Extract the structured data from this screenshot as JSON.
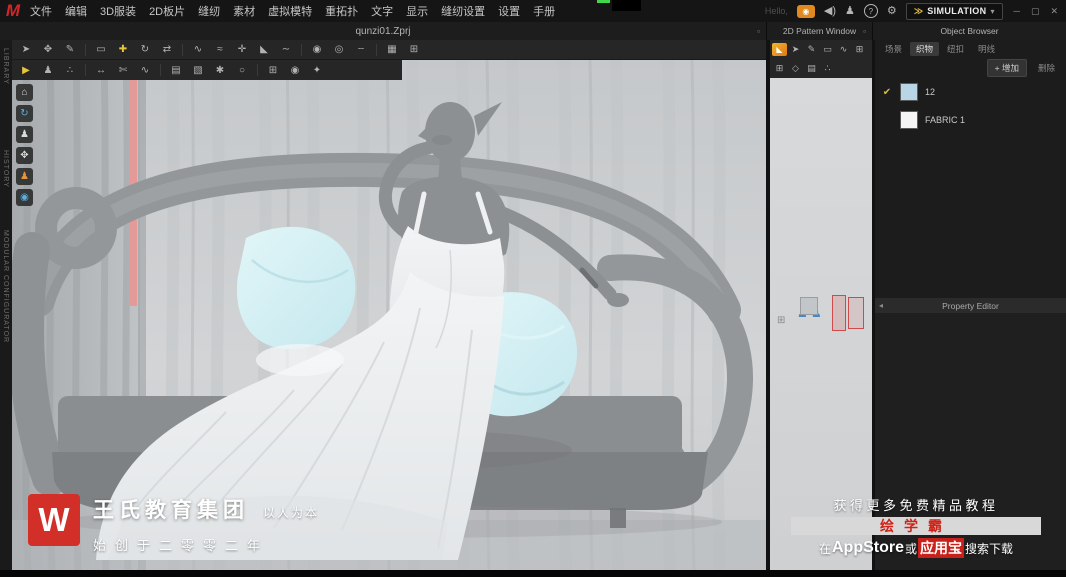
{
  "app": {
    "logo_letter": "M",
    "greeting": "Hello,",
    "simulation": {
      "chevrons": "≫",
      "label": "SIMULATION",
      "caret": "▾"
    },
    "window_controls": {
      "minimize": "─",
      "restore": "▢",
      "close": "✕"
    }
  },
  "menus": [
    "文件",
    "编辑",
    "3D服装",
    "2D板片",
    "缝纫",
    "素材",
    "虚拟模特",
    "重拓扑",
    "文字",
    "显示",
    "缝纫设置",
    "设置",
    "手册"
  ],
  "titles": {
    "project": "qunzi01.Zprj",
    "pattern_window": "2D Pattern Window",
    "object_browser": "Object Browser",
    "property_editor": "Property Editor"
  },
  "icons": {
    "camera": "◉",
    "speaker": "◀)",
    "user": "♟",
    "help": "?",
    "settings": "⚙",
    "panel_box": "▫",
    "left_arrow": "◂",
    "orange_tool": "◣"
  },
  "side_tabs": [
    "LIBRARY",
    "HISTORY",
    "MODULAR CONFIGURATOR"
  ],
  "toolbar3d_row1": [
    {
      "name": "select-tool",
      "glyph": "➤"
    },
    {
      "name": "transform-tool",
      "glyph": "✥"
    },
    {
      "name": "pen-tool",
      "glyph": "✎"
    },
    {
      "name": "rectangle-tool",
      "glyph": "▭"
    },
    {
      "name": "add-point-tool",
      "glyph": "✚"
    },
    {
      "name": "rotate-tool",
      "glyph": "↻"
    },
    {
      "name": "flip-tool",
      "glyph": "⇄"
    },
    {
      "name": "segment-sewing-tool",
      "glyph": "∿"
    },
    {
      "name": "free-sewing-tool",
      "glyph": "≈"
    },
    {
      "name": "pin-tool",
      "glyph": "✛"
    },
    {
      "name": "fold-arrangement-tool",
      "glyph": "◣"
    },
    {
      "name": "flatten-tool",
      "glyph": "∼"
    },
    {
      "name": "button-tool",
      "glyph": "◉"
    },
    {
      "name": "buttonhole-tool",
      "glyph": "◎"
    },
    {
      "name": "topstitch-tool",
      "glyph": "┄"
    },
    {
      "name": "shrinkage-tool",
      "glyph": "▦"
    },
    {
      "name": "grid-tool",
      "glyph": "⊞"
    }
  ],
  "toolbar3d_row2": [
    {
      "name": "simulate-tool",
      "glyph": "▶"
    },
    {
      "name": "show-avatar-tool",
      "glyph": "♟"
    },
    {
      "name": "arrangement-tool",
      "glyph": "∴"
    },
    {
      "name": "measure-tool",
      "glyph": "↔"
    },
    {
      "name": "scissors-tool",
      "glyph": "✄"
    },
    {
      "name": "steam-tool",
      "glyph": "∿"
    },
    {
      "name": "fabric-tool",
      "glyph": "▤"
    },
    {
      "name": "layer-tool",
      "glyph": "▧"
    },
    {
      "name": "freeze-tool",
      "glyph": "✱"
    },
    {
      "name": "deactivate-tool",
      "glyph": "○"
    },
    {
      "name": "snap-tool",
      "glyph": "⊞"
    },
    {
      "name": "capture-tool",
      "glyph": "◉"
    },
    {
      "name": "render-tool",
      "glyph": "✦"
    }
  ],
  "toolbar2d_row1": [
    {
      "name": "edit-pattern-2d-tool",
      "glyph": "➤"
    },
    {
      "name": "pen-2d-tool",
      "glyph": "✎"
    },
    {
      "name": "rectangle-2d-tool",
      "glyph": "▭"
    },
    {
      "name": "sewing-2d-tool",
      "glyph": "∿"
    },
    {
      "name": "grid-2d-tool",
      "glyph": "⊞"
    }
  ],
  "toolbar2d_row2": [
    {
      "name": "show-grid-2d-tool",
      "glyph": "⊞"
    },
    {
      "name": "seamline-2d-tool",
      "glyph": "◇"
    },
    {
      "name": "texture-2d-tool",
      "glyph": "▤"
    },
    {
      "name": "points-2d-tool",
      "glyph": "∴"
    }
  ],
  "viewport_tools": [
    {
      "name": "show-garment",
      "glyph": "⌂",
      "color": "#d8dadc"
    },
    {
      "name": "sync-view",
      "glyph": "↻",
      "color": "#5aaede"
    },
    {
      "name": "show-avatar",
      "glyph": "♟",
      "color": "#d8dadc"
    },
    {
      "name": "arrangement-points",
      "glyph": "✥",
      "color": "#d8dadc"
    },
    {
      "name": "avatar-pose",
      "glyph": "♟",
      "color": "#e2953c"
    },
    {
      "name": "camera-view",
      "glyph": "◉",
      "color": "#5aaede"
    }
  ],
  "pattern_canvas": {
    "grid_glyph": "⊞",
    "avatar_glyph": "♟"
  },
  "object_browser": {
    "tabs": [
      "场景",
      "织物",
      "纽扣",
      "明线"
    ],
    "add_button": "+ 增加",
    "delete_button": "删除",
    "check_glyph": "✔",
    "items": [
      {
        "label": "12",
        "swatch": "#b8d6e6",
        "checked": true
      },
      {
        "label": "FABRIC 1",
        "swatch": "#f5f5f5",
        "checked": false
      }
    ]
  },
  "watermark_left": {
    "logo": "W",
    "company": "王氏教育集团",
    "slogan": "以人为本",
    "since": "始创于二零零二年"
  },
  "promo": {
    "line1": "获得更多免费精品教程",
    "brand": "绘学霸",
    "cta_prefix": "在",
    "cta_store1": "AppStore",
    "cta_or": "或",
    "cta_store2": "应用宝",
    "cta_suffix": "搜索下载"
  },
  "colors": {
    "accent_orange": "#e08a1e",
    "brand_red": "#d22f28",
    "pillow_cyan": "#cdeef3",
    "selection_pink": "#e59a9a",
    "check_yellow": "#d7b93c"
  }
}
